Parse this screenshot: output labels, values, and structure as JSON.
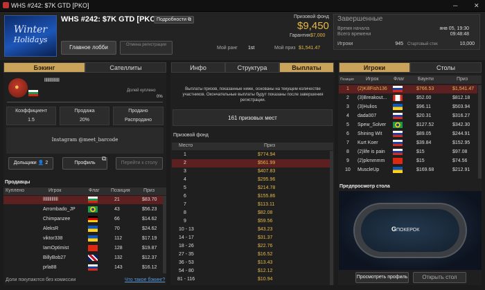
{
  "window": {
    "title": "WHS #242: $7K GTD [PKO]"
  },
  "header": {
    "logo_text1": "Winter",
    "logo_text2": "Holidays",
    "tournament_name": "WHS #242: $7K GTD [PKO]",
    "details_label": "Подробности",
    "main_lobby_label": "Главное лобби",
    "cancel_registration_label": "Отмена регистрации",
    "prize_pool_label": "Призовой фонд",
    "prize_pool_value": "$9,450",
    "guarantee_label": "Гарантия",
    "guarantee_value": "$7,000",
    "my_rank_label": "Мой ранг",
    "my_rank_value": "1st",
    "my_prize_label": "Мой приз",
    "my_prize_value": "$1,541.47"
  },
  "status": {
    "state": "Завершенные",
    "start_time_label": "Время начала",
    "start_time_value": "янв 05, 19:30",
    "elapsed_label": "Всего времени",
    "elapsed_value": "09:48:48",
    "players_label": "Игроки",
    "players_value": "945",
    "start_stack_label": "Стартовый стек",
    "start_stack_value": "10,000"
  },
  "left": {
    "tabs": [
      "Бэкинг",
      "Сателлиты"
    ],
    "player_name": "llllllllllllll",
    "bought_label": "Долей куплено",
    "bought_value": "0%",
    "stats": [
      {
        "label": "Коэффициент",
        "value": "1.5"
      },
      {
        "label": "Продажа",
        "value": "20%"
      },
      {
        "label": "Продано",
        "value": "Распродано"
      }
    ],
    "note": "Instagram @meet_barcode",
    "shareholders_label": "Дольщики",
    "shareholders_count": "2",
    "profile_label": "Профиль",
    "goto_table_label": "Перейти к столу",
    "sellers_title": "Продавцы",
    "seller_columns": [
      "Куплено",
      "Игрок",
      "Флаг",
      "Позиция",
      "Приз"
    ],
    "sellers": [
      {
        "player": "llllllllllllll",
        "pos": "21",
        "prize": "$83.70"
      },
      {
        "player": "Arrombado_JP",
        "pos": "43",
        "prize": "$56.23"
      },
      {
        "player": "Chimpanzee",
        "pos": "66",
        "prize": "$14.62"
      },
      {
        "player": "AleksR",
        "pos": "70",
        "prize": "$24.62"
      },
      {
        "player": "viktor338",
        "pos": "112",
        "prize": "$17.19"
      },
      {
        "player": "IamOptimist",
        "pos": "128",
        "prize": "$19.87"
      },
      {
        "player": "BillyBob27",
        "pos": "132",
        "prize": "$12.37"
      },
      {
        "player": "prla88",
        "pos": "143",
        "prize": "$16.12"
      }
    ],
    "footer_left": "Доли покупаются без комиссии",
    "footer_link": "Что такое бэкинг?"
  },
  "center": {
    "tabs": [
      "Инфо",
      "Структура",
      "Выплаты"
    ],
    "payout_note": "Выплаты призов, показанные ниже, основаны на текущем количестве участников. Окончательные выплаты будут показаны после завершения регистрации.",
    "paid_places": "161 призовых мест",
    "prize_fund_title": "Призовой фонд",
    "columns": [
      "Место",
      "Приз"
    ],
    "payouts": [
      {
        "place": "1",
        "prize": "$774.94"
      },
      {
        "place": "2",
        "prize": "$561.99"
      },
      {
        "place": "3",
        "prize": "$407.83"
      },
      {
        "place": "4",
        "prize": "$295.96"
      },
      {
        "place": "5",
        "prize": "$214.78"
      },
      {
        "place": "6",
        "prize": "$155.86"
      },
      {
        "place": "7",
        "prize": "$113.11"
      },
      {
        "place": "8",
        "prize": "$82.08"
      },
      {
        "place": "9",
        "prize": "$59.56"
      },
      {
        "place": "10 - 13",
        "prize": "$43.23"
      },
      {
        "place": "14 - 17",
        "prize": "$31.37"
      },
      {
        "place": "18 - 26",
        "prize": "$22.76"
      },
      {
        "place": "27 - 35",
        "prize": "$16.52"
      },
      {
        "place": "36 - 53",
        "prize": "$13.43"
      },
      {
        "place": "54 - 80",
        "prize": "$12.12"
      },
      {
        "place": "81 - 116",
        "prize": "$10.94"
      }
    ]
  },
  "right": {
    "tabs": [
      "Игроки",
      "Столы"
    ],
    "columns": [
      "Позиция",
      "Игрок",
      "Флаг",
      "Баунти",
      "Приз"
    ],
    "players": [
      {
        "pos": "1",
        "player": "(2)KillFish136",
        "bounty": "$766.53",
        "prize": "$1,541.47"
      },
      {
        "pos": "2",
        "player": "(3)Breakout...",
        "bounty": "$52.00",
        "prize": "$812.18"
      },
      {
        "pos": "3",
        "player": "(3)Hulios",
        "bounty": "$96.11",
        "prize": "$503.94"
      },
      {
        "pos": "4",
        "player": "dada007",
        "bounty": "$20.31",
        "prize": "$316.27"
      },
      {
        "pos": "5",
        "player": "Spew_Solver",
        "bounty": "$127.52",
        "prize": "$342.30"
      },
      {
        "pos": "6",
        "player": "Shining Wit",
        "bounty": "$89.05",
        "prize": "$244.91"
      },
      {
        "pos": "7",
        "player": "Kurt Koer",
        "bounty": "$39.84",
        "prize": "$152.95"
      },
      {
        "pos": "8",
        "player": "(2)life is pain",
        "bounty": "$15",
        "prize": "$97.08"
      },
      {
        "pos": "9",
        "player": "(2)pkmmmm",
        "bounty": "$15",
        "prize": "$74.56"
      },
      {
        "pos": "10",
        "player": "MuscleUp",
        "bounty": "$169.68",
        "prize": "$212.91"
      }
    ],
    "preview_title": "Предпросмотр стола",
    "table_brand": "ПОКЕРОК",
    "view_profile_label": "Просмотреть профиль",
    "open_table_label": "Открыть стол"
  }
}
